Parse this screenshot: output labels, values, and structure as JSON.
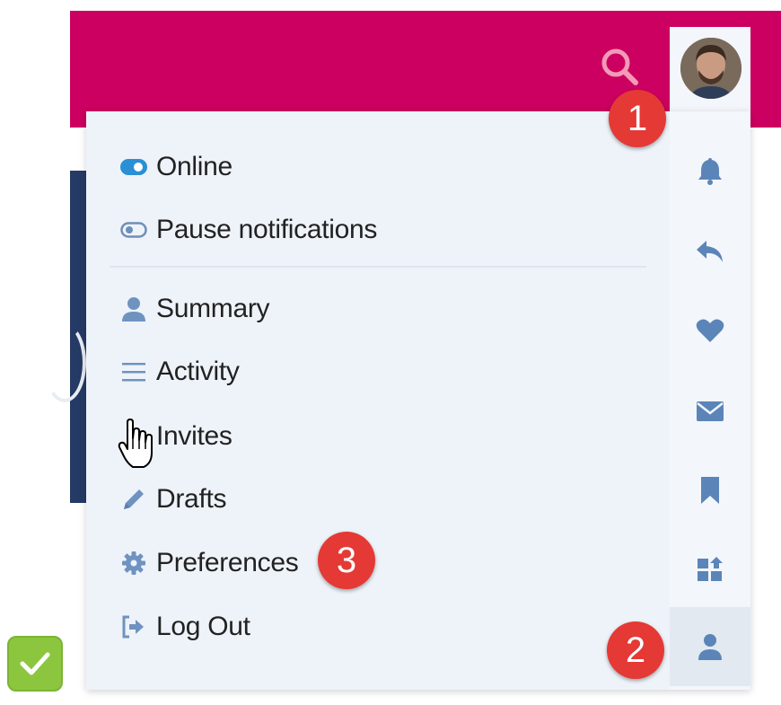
{
  "header": {
    "search_icon": "search-icon",
    "avatar_icon": "user-avatar"
  },
  "menu": {
    "status_items": [
      {
        "label": "Online",
        "icon": "toggle-on-icon"
      },
      {
        "label": "Pause notifications",
        "icon": "toggle-off-icon"
      }
    ],
    "items": [
      {
        "label": "Summary",
        "icon": "user-icon"
      },
      {
        "label": "Activity",
        "icon": "list-icon"
      },
      {
        "label": "Invites",
        "icon": "user-plus-icon"
      },
      {
        "label": "Drafts",
        "icon": "pencil-icon"
      },
      {
        "label": "Preferences",
        "icon": "gear-icon"
      },
      {
        "label": "Log Out",
        "icon": "sign-out-icon"
      }
    ]
  },
  "rail": {
    "buttons": [
      "bell-icon",
      "reply-icon",
      "heart-icon",
      "envelope-icon",
      "bookmark-icon",
      "shapes-icon",
      "user-icon"
    ],
    "active": "user-icon"
  },
  "annotations": [
    "1",
    "2",
    "3"
  ],
  "colors": {
    "header_bg": "#cc0060",
    "panel_bg": "#eef3f9",
    "rail_bg": "#f3f6fb",
    "icon_blue": "#5b85b8",
    "toggle_on": "#2b8fd6",
    "badge_red": "#e53935",
    "check_green": "#8cc63f"
  }
}
